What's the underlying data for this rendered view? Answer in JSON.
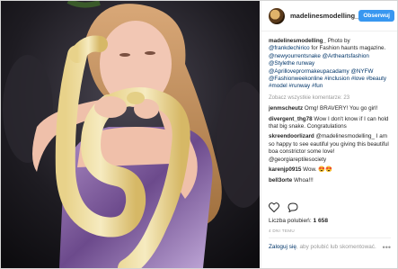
{
  "post": {
    "username": "madelinesmodelling_",
    "follow_label": "Obserwuj",
    "caption_user": "madelinesmodelling_",
    "caption_parts": [
      {
        "text": " Photo by ",
        "link": false
      },
      {
        "text": "@frankdechirico",
        "link": true
      },
      {
        "text": " for Fashion haunts magazine.",
        "link": false
      }
    ],
    "caption_tags": [
      "@newyourrentsnake",
      "@Artheartsfashion",
      "@Stylethe runway",
      "@Aprilloveprormakeupacadamy",
      "@NYFW",
      "@Fashionweekonline",
      "#inclusion",
      "#love",
      "#beauty",
      "#model",
      "#runway",
      "#fun"
    ],
    "load_more": "Zobacz wszystkie komentarze: 23",
    "comments": [
      {
        "user": "jenmscheutz",
        "text": " Omg! BRAVERY! You go girl!"
      },
      {
        "user": "divergent_thg78",
        "text": " Wow I don't know if I can hold that big snake. Congratulations"
      },
      {
        "user": "skreendoorlizard",
        "text": " @madelinesmodelling_ I am so happy to see eautiful you giving this beautiful boa constrictor some love! @georgiareptilesociety"
      },
      {
        "user": "karenjp0915",
        "text": " Wow. 😍😍"
      },
      {
        "user": "bell3orte",
        "text": " Whoa!!!"
      }
    ],
    "likes_label": "Liczba polubień:",
    "likes_count": "1 658",
    "time": "4 DNI TEMU",
    "login_link": "Zaloguj się",
    "login_text": ", aby polubić lub skomentować."
  },
  "icons": {
    "like": "heart-icon",
    "comment": "comment-icon",
    "more": "more-options-icon"
  },
  "colors": {
    "follow_button": "#3897f0",
    "link": "#003569",
    "muted": "#999999"
  }
}
